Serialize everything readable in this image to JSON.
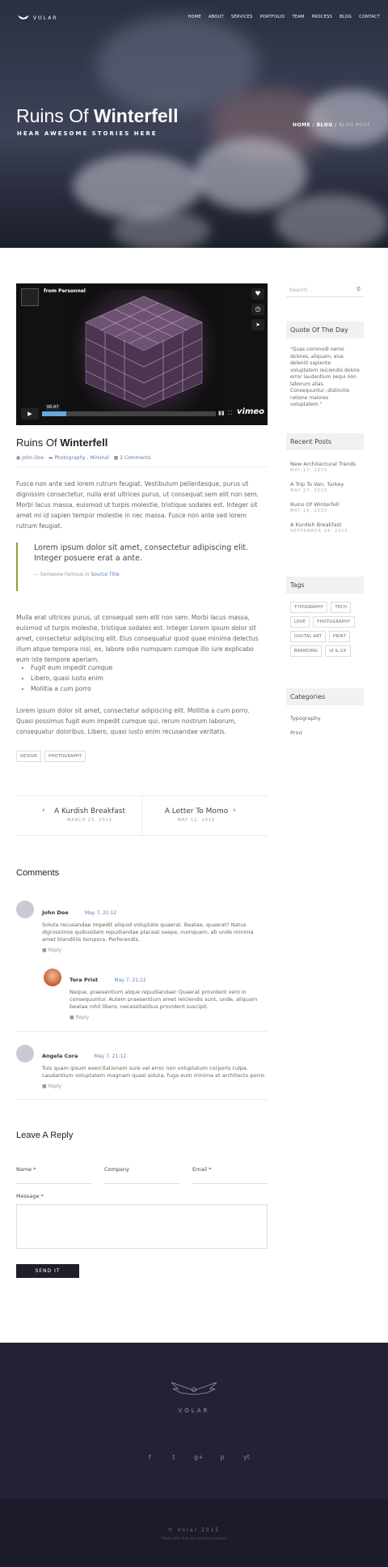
{
  "header": {
    "logo": "VOLAR",
    "nav": [
      "HOME",
      "ABOUT",
      "SERVICES",
      "PORTFOLIO",
      "TEAM",
      "PROCESS",
      "BLOG",
      "CONTACT"
    ]
  },
  "hero": {
    "title_light": "Ruins Of",
    "title_bold": "Winterfell",
    "subtitle": "HEAR AWESOME STORIES HERE",
    "breadcrumb": [
      "HOME",
      "BLOG",
      "BLOG POST"
    ]
  },
  "video": {
    "from": "from",
    "channel": "Personnel",
    "time": "00:47",
    "brand": "vimeo"
  },
  "post": {
    "title_light": "Ruins Of",
    "title_bold": "Winterfell",
    "author": "John Doe",
    "categories": "Photography , Minimal",
    "comments": "2 Comments",
    "p1": "Fusce non ante sed lorem rutrum feugiat. Vestibulum pellentesque, purus ut dignissim consectetur, nulla erat ultrices purus, ut consequat sem elit non sem. Morbi lacus massa, euismod ut turpis molestie, tristique sodales est. Integer sit amet mi id sapien tempor molestie in nec massa. Fusce non ante sed lorem rutrum feugiat.",
    "quote": "Lorem ipsum dolor sit amet, consectetur adipiscing elit. Integer posuere erat a ante.",
    "quote_cite": "Someone Famous in",
    "quote_source": "Source Title",
    "p2": "Mulla erat ultrices purus, ut consequat sem elit non sem. Morbi lacus massa, euismod ut turpis molestie, tristique sodales est. Integer Lorem ipsum dolor sit amet, consectetur adipiscing elit. Eius consequatur quod quae minima delectus illum atque tempora nisi, ex, labore odio numquam cumque illo iure explicabo eum iste tempore aperiam.",
    "list": [
      "Fugit eum impedit cumque",
      "Libero, quasi iusto enim",
      "Mollitia a cum porro"
    ],
    "p3": "Lorem ipsum dolor sit amet, consectetur adipiscing elit. Mollitia a cum porro. Quasi possimus fugit eum impedit cumque qui, rerum nostrum laborum, consequatur doloribus. Libero, quasi iusto enim recusandae veritatis.",
    "tags": [
      "DESIGN",
      "PHOTOGRAPHY"
    ]
  },
  "postnav": {
    "prev_title": "A Kurdish Breakfast",
    "prev_date": "MARCH 23, 2015",
    "next_title": "A Letter To Momo",
    "next_date": "MAY 12, 2015"
  },
  "comments": {
    "heading": "Comments",
    "reply": "Reply",
    "items": [
      {
        "name": "John Doe",
        "date": "May 7, 21:12",
        "text": "Soluta recusandae impedit aliquid voluptate quaerat. Beatae, quaerat? Natus dignissimos quibusdam repudiandae placeat saepe, numquam, ab unde minima amet blanditiis tempora. Perferendis."
      },
      {
        "name": "Tora Prist",
        "date": "May 7, 21:12",
        "text": "Neque, praesentium atque repudiandae! Quaerat provident vero in consequuntur. Autem praesentium amet reiciendis sunt, unde, aliquam beatae nihil libero, necessitatibus provident suscipit."
      },
      {
        "name": "Angela Cora",
        "date": "May 7, 21:12",
        "text": "Tuis quam ipsum exercitationem sure vel error non voluptatum corporis culpa. Laudantium voluptatem magnam quasi soluta, fuga eum minima et architecto porro."
      }
    ]
  },
  "form": {
    "heading": "Leave A Reply",
    "name": "Name *",
    "company": "Company",
    "email": "Email *",
    "message": "Message *",
    "send": "SEND IT"
  },
  "sidebar": {
    "search_placeholder": "Search...",
    "quote_title": "Quote Of The Day",
    "quote_text": "\"Quas commodi nemo dolores, aliquam, eius deleniti sapiente voluptatem reiciendis dolore error laudantium sequi non laborum alias. Consequuntur, distinctio ratione maiores voluptatem.\"",
    "recent_title": "Recent Posts",
    "recent": [
      {
        "title": "New Architectural Trends",
        "date": "MAY 12, 2015"
      },
      {
        "title": "A Trip To Van, Turkey",
        "date": "MAY 27, 2015"
      },
      {
        "title": "Ruins Of Winterfell",
        "date": "MAY 16, 2015"
      },
      {
        "title": "A Kurdish Breakfast",
        "date": "SEPTEMBER 14, 2015"
      }
    ],
    "tags_title": "Tags",
    "tags": [
      "TYPOGRAPHY",
      "TECH",
      "LOVE",
      "PHOTOGRAPHY",
      "DIGITAL ART",
      "PRINT",
      "BRANDING",
      "UI & UX"
    ],
    "cat_title": "Categories",
    "categories": [
      "Typography",
      "Print"
    ]
  },
  "footer": {
    "logo": "VOLAR",
    "social": [
      "f",
      "t",
      "g+",
      "p",
      "yt"
    ],
    "copyright": "© Volar 2015",
    "made": "Made with love for quantum people"
  }
}
